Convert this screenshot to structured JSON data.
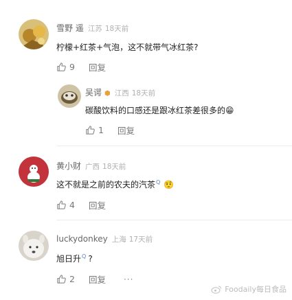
{
  "comments": [
    {
      "username": "雪野 遥",
      "location": "江苏",
      "time": "18天前",
      "text": "柠檬+红茶+气泡，这不就带气冰红茶?",
      "likes": "9",
      "reply_label": "回复"
    },
    {
      "username": "吴谔",
      "location": "江西",
      "time": "18天前",
      "text": "碳酸饮料的口感还是跟冰红茶差很多的😁",
      "likes": "1",
      "reply_label": "回复"
    },
    {
      "username": "黄小财",
      "location": "广西",
      "time": "18天前",
      "text": "这不就是之前的农夫的汽茶",
      "emoji": "🤨",
      "likes": "4",
      "reply_label": "回复"
    },
    {
      "username": "luckydonkey",
      "location": "上海",
      "time": "17天前",
      "text": "旭日升",
      "trail": "?",
      "likes": "2",
      "reply_label": "回复",
      "more": "···"
    }
  ],
  "watermark": "Foodaily每日食品",
  "colors": {
    "text": "#222222",
    "meta": "#b0b0b0",
    "name": "#666666",
    "action": "#777777"
  },
  "icons": [
    "thumbs-up-icon",
    "search-icon",
    "weibo-icon"
  ]
}
